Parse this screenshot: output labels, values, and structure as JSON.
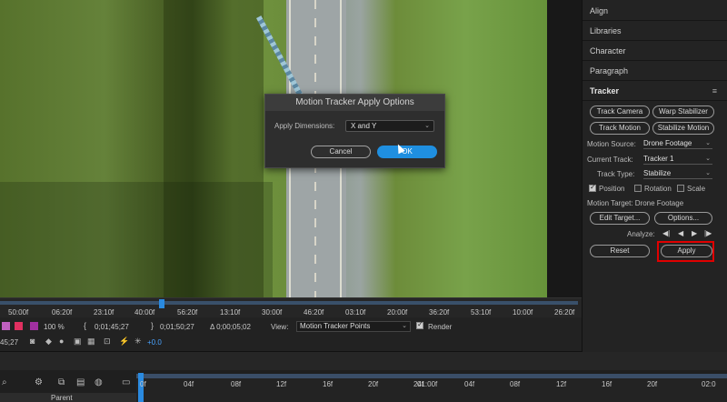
{
  "viewer": {
    "dialog": {
      "title": "Motion Tracker Apply Options",
      "apply_dimensions_label": "Apply Dimensions:",
      "apply_dimensions_value": "X and Y",
      "cancel_label": "Cancel",
      "ok_label": "OK"
    }
  },
  "panel": {
    "items": [
      "Align",
      "Libraries",
      "Character",
      "Paragraph"
    ],
    "tracker": {
      "title": "Tracker",
      "menu_icon": "≡",
      "track_camera": "Track Camera",
      "warp_stabilizer": "Warp Stabilizer",
      "track_motion": "Track Motion",
      "stabilize_motion": "Stabilize Motion",
      "motion_source_label": "Motion Source:",
      "motion_source_value": "Drone Footage",
      "current_track_label": "Current Track:",
      "current_track_value": "Tracker 1",
      "track_type_label": "Track Type:",
      "track_type_value": "Stabilize",
      "position_label": "Position",
      "position_checked": true,
      "rotation_label": "Rotation",
      "rotation_checked": false,
      "scale_label": "Scale",
      "scale_checked": false,
      "motion_target": "Motion Target: Drone Footage",
      "edit_target": "Edit Target...",
      "options": "Options...",
      "analyze_label": "Analyze:",
      "reset": "Reset",
      "apply": "Apply"
    }
  },
  "ruler": {
    "ticks": [
      "50:00f",
      "06:20f",
      "23:10f",
      "40:00f",
      "56:20f",
      "13:10f",
      "30:00f",
      "46:20f",
      "03:10f",
      "20:00f",
      "36:20f",
      "53:10f",
      "10:00f",
      "26:20f"
    ]
  },
  "controls": {
    "zoom": "100 %",
    "time_start": "0;01;45;27",
    "time_end": "0;01;50;27",
    "time_delta": "Δ 0;00;05;02",
    "view_label": "View:",
    "view_value": "Motion Tracker Points",
    "render_label": "Render",
    "current_time_fragment": "45;27",
    "exposure": "+0.0"
  },
  "timeline": {
    "ticks": [
      "0f",
      "04f",
      "08f",
      "12f",
      "16f",
      "20f",
      "24f",
      "01:00f",
      "04f",
      "08f",
      "12f",
      "16f",
      "20f",
      "24f",
      "02:0"
    ],
    "layer_label": "Parent"
  },
  "colors": {
    "accent": "#1f8fe0",
    "highlight": "#e00000"
  }
}
